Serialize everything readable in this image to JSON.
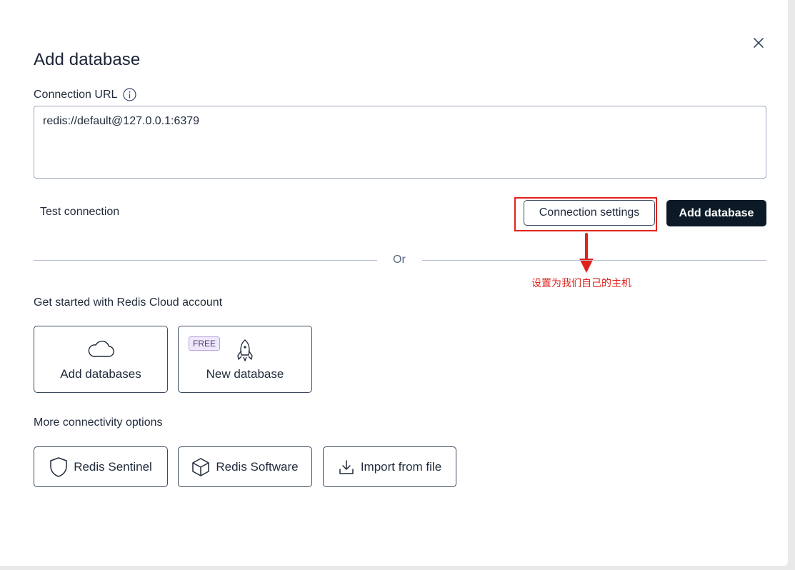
{
  "dialog": {
    "title": "Add database",
    "close_icon": "close-icon"
  },
  "connection_url": {
    "label": "Connection URL",
    "info_icon": "info-icon",
    "value": "redis://default@127.0.0.1:6379"
  },
  "actions": {
    "test_connection": "Test connection",
    "connection_settings": "Connection settings",
    "add_database": "Add database"
  },
  "annotation": {
    "text": "设置为我们自己的主机",
    "color": "#e0221c"
  },
  "divider": {
    "or_text": "Or"
  },
  "cloud": {
    "label": "Get started with Redis Cloud account",
    "tiles": [
      {
        "label": "Add databases",
        "icon": "cloud-icon"
      },
      {
        "label": "New database",
        "icon": "rocket-icon",
        "badge": "FREE"
      }
    ]
  },
  "more": {
    "label": "More connectivity options",
    "options": [
      {
        "label": "Redis Sentinel",
        "icon": "shield-icon"
      },
      {
        "label": "Redis Software",
        "icon": "cube-icon"
      },
      {
        "label": "Import from file",
        "icon": "download-icon"
      }
    ]
  },
  "colors": {
    "primary_button": "#0b1a26",
    "border": "#3d4a5e",
    "badge_bg": "#efe8fb"
  }
}
